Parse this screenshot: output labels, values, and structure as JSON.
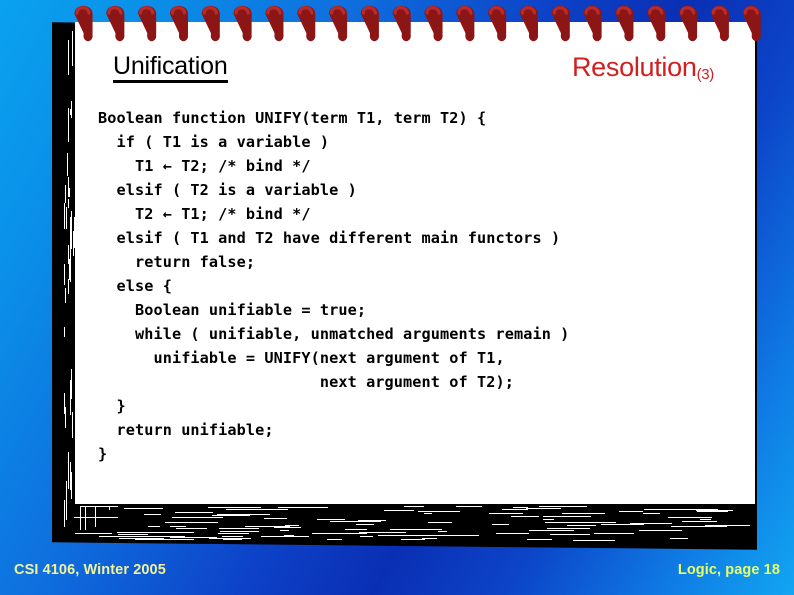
{
  "slide": {
    "background_from": "#0aa2f0",
    "background_to": "#0a2fb4"
  },
  "header": {
    "title_left": "Unification",
    "title_right_main": "Resolution",
    "title_right_sub": "(3)",
    "title_right_color": "#d21f1f",
    "title_left_color": "#000000"
  },
  "binding": {
    "ring_count": 22,
    "ring_color": "#8c1616",
    "ring_highlight": "#b82b2b"
  },
  "code": {
    "language": "pseudocode",
    "lines": [
      "Boolean function UNIFY(term T1, term T2) {",
      "  if ( T1 is a variable )",
      "    T1 ← T2; /* bind */",
      "  elsif ( T2 is a variable )",
      "    T2 ← T1; /* bind */",
      "  elsif ( T1 and T2 have different main functors )",
      "    return false;",
      "  else {",
      "    Boolean unifiable = true;",
      "    while ( unifiable, unmatched arguments remain )",
      "      unifiable = UNIFY(next argument of T1,",
      "                        next argument of T2);",
      "  }",
      "  return unifiable;",
      "}"
    ]
  },
  "footer": {
    "course": "CSI 4106, Winter 2005",
    "page_label": "Logic, page 18",
    "course_color": "#f2f29a",
    "page_color": "#eaff66"
  }
}
